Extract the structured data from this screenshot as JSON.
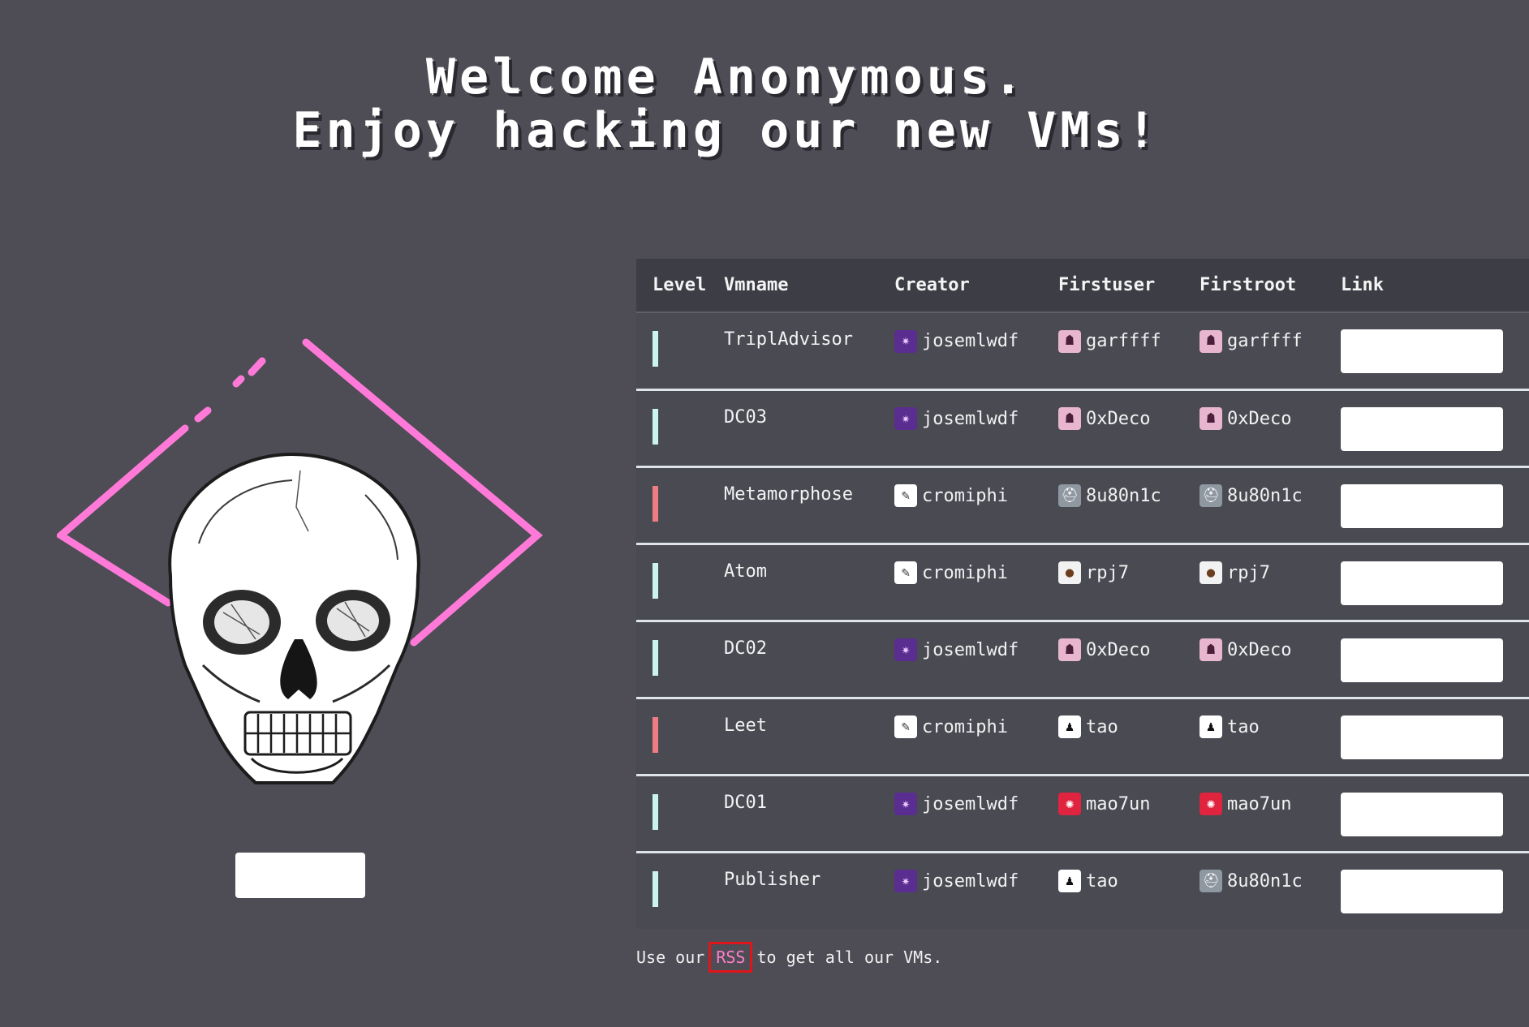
{
  "heading": {
    "line1": "Welcome Anonymous.",
    "line2": "Enjoy hacking our new VMs!"
  },
  "table": {
    "headers": {
      "level": "Level",
      "vmname": "Vmname",
      "creator": "Creator",
      "firstuser": "Firstuser",
      "firstroot": "Firstroot",
      "link": "Link"
    },
    "rows": [
      {
        "level_color": "#cbf3ef",
        "vmname": "TriplAdvisor",
        "creator": "josemlwdf",
        "creator_avatar": "purple-demon",
        "firstuser": "garffff",
        "firstuser_avatar": "pink-hacker",
        "firstroot": "garffff",
        "firstroot_avatar": "pink-hacker"
      },
      {
        "level_color": "#cbf3ef",
        "vmname": "DC03",
        "creator": "josemlwdf",
        "creator_avatar": "purple-demon",
        "firstuser": "0xDeco",
        "firstuser_avatar": "pink-hacker",
        "firstroot": "0xDeco",
        "firstroot_avatar": "pink-hacker"
      },
      {
        "level_color": "#f07c83",
        "vmname": "Metamorphose",
        "creator": "cromiphi",
        "creator_avatar": "sketch",
        "firstuser": "8u80n1c",
        "firstuser_avatar": "gray-helmet",
        "firstroot": "8u80n1c",
        "firstroot_avatar": "gray-helmet"
      },
      {
        "level_color": "#cbf3ef",
        "vmname": "Atom",
        "creator": "cromiphi",
        "creator_avatar": "sketch",
        "firstuser": "rpj7",
        "firstuser_avatar": "monkey",
        "firstroot": "rpj7",
        "firstroot_avatar": "monkey"
      },
      {
        "level_color": "#cbf3ef",
        "vmname": "DC02",
        "creator": "josemlwdf",
        "creator_avatar": "purple-demon",
        "firstuser": "0xDeco",
        "firstuser_avatar": "pink-hacker",
        "firstroot": "0xDeco",
        "firstroot_avatar": "pink-hacker"
      },
      {
        "level_color": "#f07c83",
        "vmname": "Leet",
        "creator": "cromiphi",
        "creator_avatar": "sketch",
        "firstuser": "tao",
        "firstuser_avatar": "silhouette",
        "firstroot": "tao",
        "firstroot_avatar": "silhouette"
      },
      {
        "level_color": "#cbf3ef",
        "vmname": "DC01",
        "creator": "josemlwdf",
        "creator_avatar": "purple-demon",
        "firstuser": "mao7un",
        "firstuser_avatar": "red-creature",
        "firstroot": "mao7un",
        "firstroot_avatar": "red-creature"
      },
      {
        "level_color": "#cbf3ef",
        "vmname": "Publisher",
        "creator": "josemlwdf",
        "creator_avatar": "purple-demon",
        "firstuser": "tao",
        "firstuser_avatar": "silhouette",
        "firstroot": "8u80n1c",
        "firstroot_avatar": "gray-helmet"
      }
    ]
  },
  "footer": {
    "prefix": "Use our ",
    "rss_label": "RSS",
    "suffix": " to get all our VMs."
  },
  "colors": {
    "background": "#4e4c55",
    "table_bg": "#494a52",
    "rss_link": "#ff7ec9",
    "rss_highlight": "#e0151b",
    "diamond": "#ff7ad8"
  },
  "avatars": {
    "purple-demon": {
      "bg": "#5a2d91",
      "fg": "#e6c8ff",
      "glyph": "✷"
    },
    "pink-hacker": {
      "bg": "#e8b6cf",
      "fg": "#4a1f3a",
      "glyph": "☗"
    },
    "sketch": {
      "bg": "#ffffff",
      "fg": "#333333",
      "glyph": "✎"
    },
    "gray-helmet": {
      "bg": "#8f97a0",
      "fg": "#ffffff",
      "glyph": "⛑"
    },
    "monkey": {
      "bg": "#f2f2f2",
      "fg": "#6b3f1d",
      "glyph": "●"
    },
    "silhouette": {
      "bg": "#ffffff",
      "fg": "#111111",
      "glyph": "♟"
    },
    "red-creature": {
      "bg": "#e0233f",
      "fg": "#ffffff",
      "glyph": "✺"
    }
  }
}
